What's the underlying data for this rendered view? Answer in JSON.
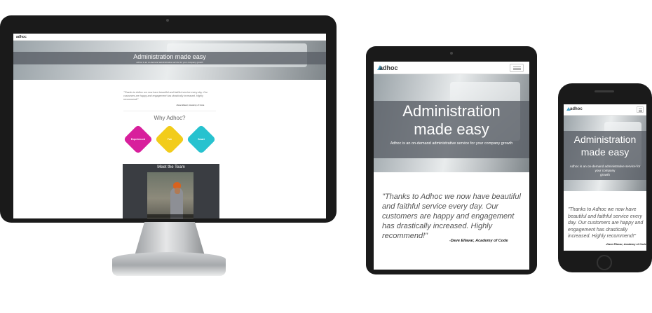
{
  "site": {
    "logo": "adhoc",
    "nav_links": "",
    "hero_title": "Administration made easy",
    "hero_title_line1": "Administration",
    "hero_title_line2": "made easy",
    "hero_subtitle": "Adhoc is an on-demand administrative service for your company growth",
    "hero_subtitle_line1": "Adhoc is an on-demand administrative service for your company",
    "hero_subtitle_line2": "growth",
    "quote": "\"Thanks to Adhoc we now have beautiful and faithful service every day. Our customers are happy and engagement has drastically increased. Highly recommend!\"",
    "quote_author": "-Dave Ellavar, Academy of Code",
    "why_title": "Why Adhoc?",
    "features": [
      {
        "label": "Experienced",
        "color": "#d81f9c"
      },
      {
        "label": "Fair",
        "color": "#f2cc1a"
      },
      {
        "label": "Smart",
        "color": "#27c2cf"
      }
    ],
    "team_title": "Meet the Team"
  },
  "icons": {
    "menu": "hamburger-menu-icon",
    "logo_mark": "adhoc-logo-triangle-icon"
  }
}
